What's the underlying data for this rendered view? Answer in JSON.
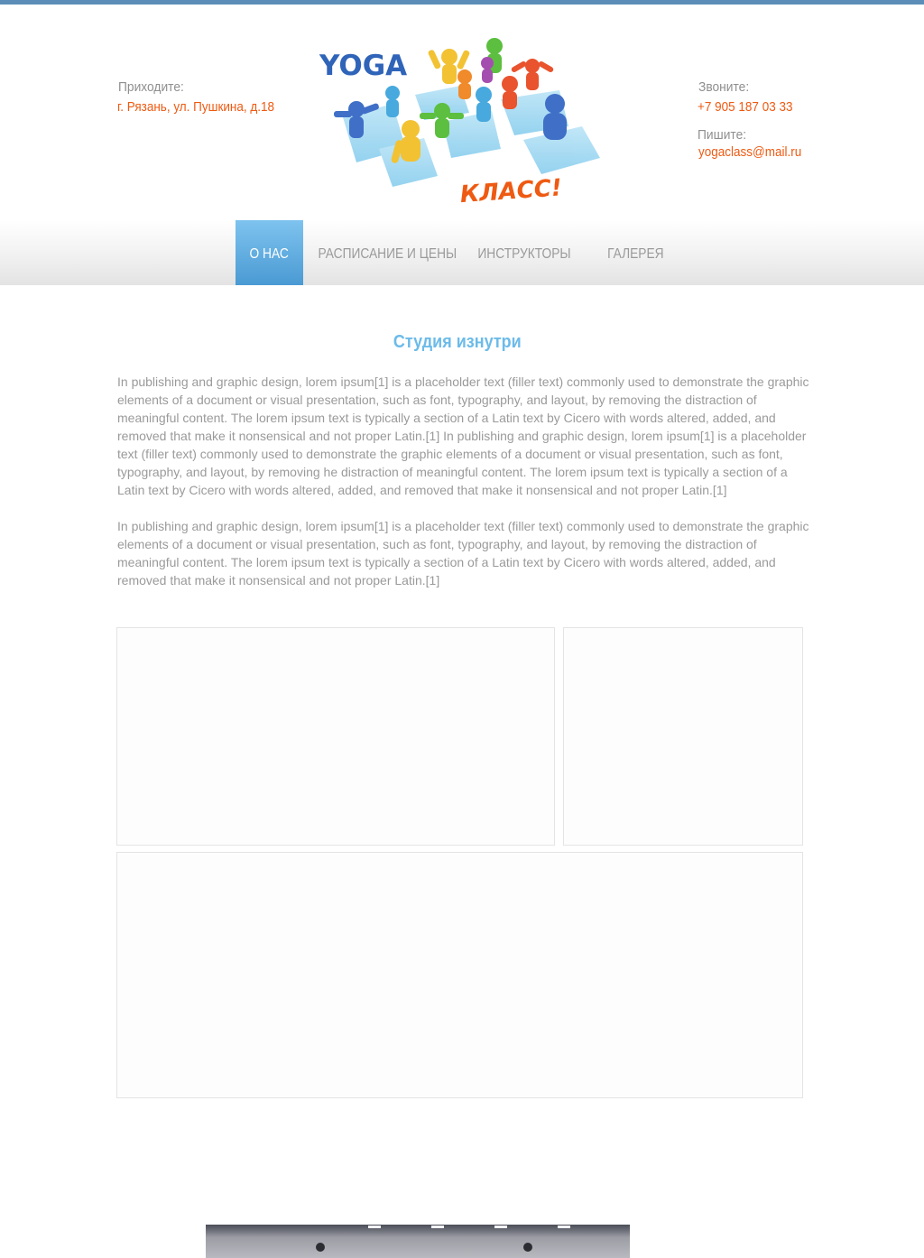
{
  "header": {
    "address_label": "Приходите:",
    "address": "г. Рязань, ул. Пушкина, д.18",
    "phone_label": "Звоните:",
    "phone": "+7 905 187 03 33",
    "email_label": "Пишите:",
    "email": "yogaclass@mail.ru"
  },
  "logo": {
    "top_text": "YOGA",
    "bottom_text": "КЛАСС!"
  },
  "nav": {
    "items": [
      {
        "label": "О НАС",
        "active": true
      },
      {
        "label": "РАСПИСАНИЕ И ЦЕНЫ",
        "active": false
      },
      {
        "label": "ИНСТРУКТОРЫ",
        "active": false
      },
      {
        "label": "ГАЛЕРЕЯ",
        "active": false
      }
    ]
  },
  "main": {
    "title": "Студия изнутри",
    "paragraphs": [
      "In publishing and graphic design, lorem ipsum[1] is a placeholder text (filler text) commonly used to demonstrate the graphic elements of a document or visual presentation, such as font, typography, and layout, by removing the distraction of meaningful content. The lorem ipsum text is typically a section of a Latin text by Cicero with words altered, added, and removed that make it nonsensical and not proper Latin.[1]  In publishing and graphic design, lorem ipsum[1] is a placeholder text (filler text) commonly used to demonstrate the graphic elements of a document or visual presentation, such as font, typography, and layout, by removing he distraction of meaningful content. The lorem ipsum text is typically a section of a Latin text by Cicero with words altered, added, and removed that make it nonsensical and not proper Latin.[1]",
      "In publishing and graphic design, lorem ipsum[1] is a placeholder text (filler text) commonly used to demonstrate the graphic elements of a document or visual presentation, such as font, typography, and layout, by removing the distraction of meaningful content. The lorem ipsum text is typically a section of a Latin text by Cicero with words altered, added, and removed that make it nonsensical and not proper Latin.[1]"
    ]
  },
  "colors": {
    "accent_orange": "#ee5a12",
    "accent_blue": "#6cbbe9",
    "nav_active": "#4a9ad3",
    "text_gray": "#9a9a9a"
  }
}
